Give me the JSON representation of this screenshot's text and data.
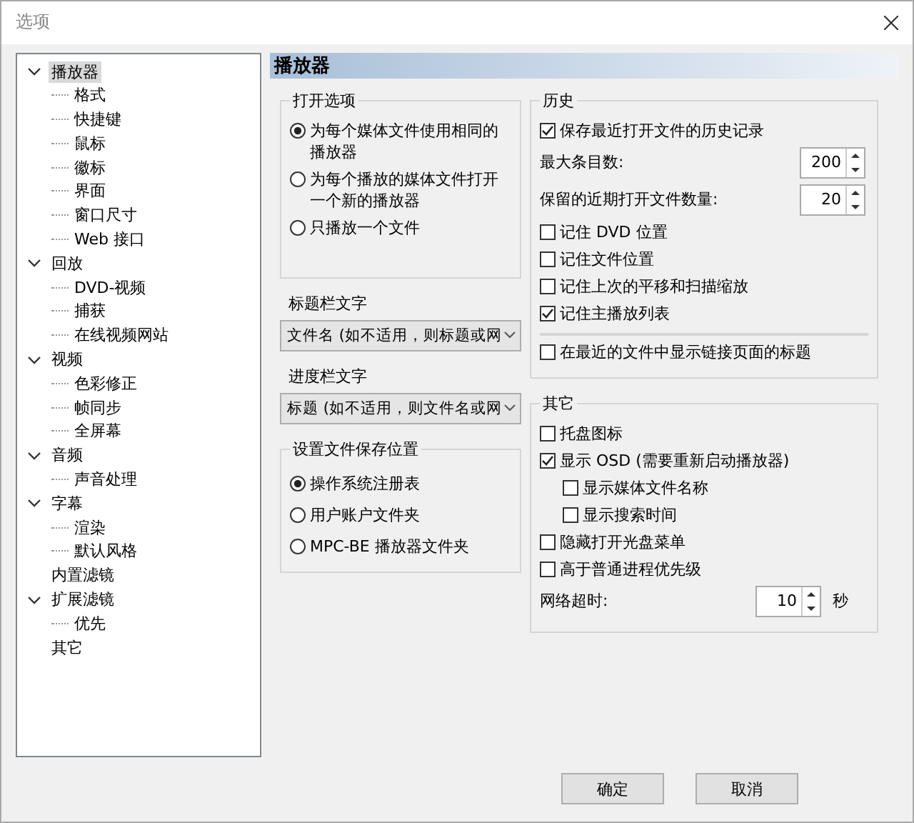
{
  "window": {
    "title": "选项"
  },
  "tree": [
    {
      "label": "播放器",
      "selected": true,
      "expanded": true,
      "children": [
        {
          "label": "格式",
          "selected": false
        },
        {
          "label": "快捷键",
          "selected": false
        },
        {
          "label": "鼠标",
          "selected": false
        },
        {
          "label": "徽标",
          "selected": false
        },
        {
          "label": "界面",
          "selected": false
        },
        {
          "label": "窗口尺寸",
          "selected": false
        },
        {
          "label": "Web 接口",
          "selected": false
        }
      ]
    },
    {
      "label": "回放",
      "selected": false,
      "expanded": true,
      "children": [
        {
          "label": "DVD-视频",
          "selected": false
        },
        {
          "label": "捕获",
          "selected": false
        },
        {
          "label": "在线视频网站",
          "selected": false
        }
      ]
    },
    {
      "label": "视频",
      "selected": false,
      "expanded": true,
      "children": [
        {
          "label": "色彩修正",
          "selected": false
        },
        {
          "label": "帧同步",
          "selected": false
        },
        {
          "label": "全屏幕",
          "selected": false
        }
      ]
    },
    {
      "label": "音频",
      "selected": false,
      "expanded": true,
      "children": [
        {
          "label": "声音处理",
          "selected": false
        }
      ]
    },
    {
      "label": "字幕",
      "selected": false,
      "expanded": true,
      "children": [
        {
          "label": "渲染",
          "selected": false
        },
        {
          "label": "默认风格",
          "selected": false
        }
      ]
    },
    {
      "label": "内置滤镜",
      "selected": false
    },
    {
      "label": "扩展滤镜",
      "selected": false,
      "expanded": true,
      "children": [
        {
          "label": "优先",
          "selected": false
        }
      ]
    },
    {
      "label": "其它",
      "selected": false
    }
  ],
  "page_title": "播放器",
  "open_options": {
    "title": "打开选项",
    "options": [
      {
        "label": "为每个媒体文件使用相同的播放器",
        "selected": true
      },
      {
        "label": "为每个播放的媒体文件打开一个新的播放器",
        "selected": false
      },
      {
        "label": "只播放一个文件",
        "selected": false
      }
    ]
  },
  "dropdowns": [
    {
      "label": "标题栏文字",
      "value": "文件名 (如不适用，则标题或网"
    },
    {
      "label": "进度栏文字",
      "value": "标题 (如不适用，则文件名或网"
    }
  ],
  "save_location": {
    "title": "设置文件保存位置",
    "options": [
      {
        "label": "操作系统注册表",
        "selected": true
      },
      {
        "label": "用户账户文件夹",
        "selected": false
      },
      {
        "label": "MPC-BE 播放器文件夹",
        "selected": false
      }
    ]
  },
  "history": {
    "title": "历史",
    "items": [
      {
        "kind": "check",
        "label": "保存最近打开文件的历史记录",
        "checked": true
      },
      {
        "kind": "spin",
        "label": "最大条目数:",
        "value": "200"
      },
      {
        "kind": "spin",
        "label": "保留的近期打开文件数量:",
        "value": "20"
      },
      {
        "kind": "check",
        "label": "记住 DVD 位置",
        "checked": false
      },
      {
        "kind": "check",
        "label": "记住文件位置",
        "checked": false
      },
      {
        "kind": "check",
        "label": "记住上次的平移和扫描缩放",
        "checked": false
      },
      {
        "kind": "check",
        "label": "记住主播放列表",
        "checked": true
      }
    ],
    "after_divider": [
      {
        "kind": "check",
        "label": "在最近的文件中显示链接页面的标题",
        "checked": false
      }
    ]
  },
  "other": {
    "title": "其它",
    "items": [
      {
        "kind": "check",
        "label": "托盘图标",
        "checked": false
      },
      {
        "kind": "check",
        "label": "显示 OSD (需要重新启动播放器)",
        "checked": true,
        "children": [
          {
            "kind": "check",
            "label": "显示媒体文件名称",
            "checked": false
          },
          {
            "kind": "check",
            "label": "显示搜索时间",
            "checked": false
          }
        ]
      },
      {
        "kind": "check",
        "label": "隐藏打开光盘菜单",
        "checked": false
      },
      {
        "kind": "check",
        "label": "高于普通进程优先级",
        "checked": false
      },
      {
        "kind": "spin",
        "label": "网络超时:",
        "value": "10",
        "unit": "秒"
      }
    ]
  },
  "buttons": [
    "确定",
    "取消"
  ]
}
